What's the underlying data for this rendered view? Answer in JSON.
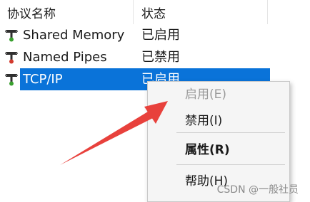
{
  "table": {
    "columns": [
      "协议名称",
      "状态"
    ],
    "rows": [
      {
        "name": "Shared Memory",
        "status": "已启用",
        "icon": "network-protocol-icon",
        "selected": false
      },
      {
        "name": "Named Pipes",
        "status": "已禁用",
        "icon": "network-protocol-icon",
        "selected": false
      },
      {
        "name": "TCP/IP",
        "status": "已启用",
        "icon": "network-protocol-icon",
        "selected": true
      }
    ]
  },
  "context_menu": {
    "items": [
      {
        "label": "启用(E)",
        "disabled": true
      },
      {
        "label": "禁用(I)",
        "disabled": false
      },
      {
        "label": "属性(R)",
        "disabled": false,
        "bold": true
      },
      {
        "label": "帮助(H)",
        "disabled": false
      }
    ]
  },
  "watermark": "CSDN @一般社员",
  "colors": {
    "selection": "#0a73d9",
    "arrow": "#e8413c",
    "menu_background": "#f5f5f5"
  }
}
